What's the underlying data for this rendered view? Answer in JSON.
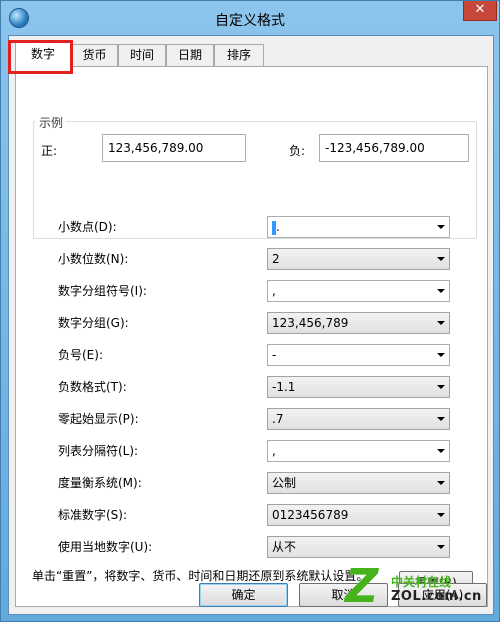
{
  "window": {
    "title": "自定义格式",
    "close_glyph": "✕"
  },
  "tabs": [
    {
      "label": "数字",
      "active": true
    },
    {
      "label": "货币",
      "active": false
    },
    {
      "label": "时间",
      "active": false
    },
    {
      "label": "日期",
      "active": false
    },
    {
      "label": "排序",
      "active": false
    }
  ],
  "sample": {
    "legend": "示例",
    "positive_label": "正:",
    "positive_value": "123,456,789.00",
    "negative_label": "负:",
    "negative_value": "-123,456,789.00"
  },
  "settings": [
    {
      "label": "小数点(D):",
      "value": ".",
      "style": "editable"
    },
    {
      "label": "小数位数(N):",
      "value": "2",
      "style": "dropdown"
    },
    {
      "label": "数字分组符号(I):",
      "value": ",",
      "style": "editable"
    },
    {
      "label": "数字分组(G):",
      "value": "123,456,789",
      "style": "dropdown"
    },
    {
      "label": "负号(E):",
      "value": "-",
      "style": "editable"
    },
    {
      "label": "负数格式(T):",
      "value": "-1.1",
      "style": "dropdown"
    },
    {
      "label": "零起始显示(P):",
      "value": ".7",
      "style": "dropdown"
    },
    {
      "label": "列表分隔符(L):",
      "value": ",",
      "style": "editable"
    },
    {
      "label": "度量衡系统(M):",
      "value": "公制",
      "style": "dropdown"
    },
    {
      "label": "标准数字(S):",
      "value": "0123456789",
      "style": "dropdown"
    },
    {
      "label": "使用当地数字(U):",
      "value": "从不",
      "style": "dropdown"
    }
  ],
  "reset": {
    "note": "单击“重置”，将数字、货币、时间和日期还原到系统默认设置。",
    "button_label": "重置(R)"
  },
  "footer": {
    "ok_label": "确定",
    "cancel_label": "取消",
    "apply_label": "应用(A)"
  },
  "watermark": {
    "logo_glyph": "Z",
    "line1": "中关村在线",
    "line2": "ZOL.com.cn"
  },
  "colors": {
    "highlight": "#e0211f",
    "watermark_green": "#46b21c"
  }
}
